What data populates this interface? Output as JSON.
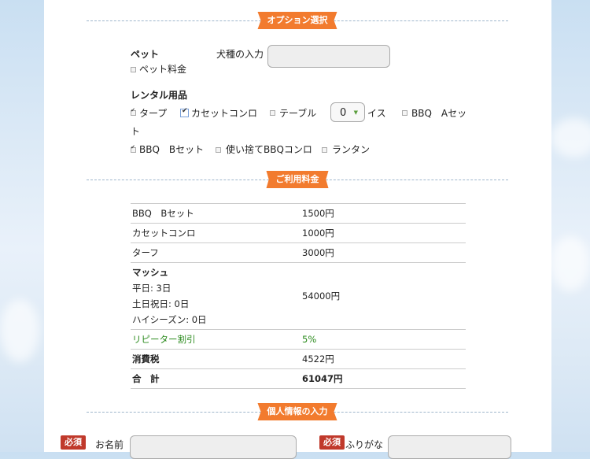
{
  "sections": {
    "options": "オプション選択",
    "fees": "ご利用料金",
    "personal": "個人情報の入力"
  },
  "pet": {
    "heading": "ペット",
    "breed_label": "犬種の入力",
    "fee_label": "ペット料金",
    "fee_checked": false
  },
  "rental": {
    "heading": "レンタル用品",
    "items": [
      {
        "label": "タープ",
        "checked": true
      },
      {
        "label": "カセットコンロ",
        "checked": true
      },
      {
        "label": "テーブル",
        "checked": false
      },
      {
        "label": "イス",
        "quantity": "0"
      },
      {
        "label": "BBQ　Aセット",
        "checked": false
      },
      {
        "label": "BBQ　Bセット",
        "checked": true
      },
      {
        "label": "使い捨てBBQコンロ",
        "checked": false
      },
      {
        "label": "ランタン",
        "checked": false
      }
    ],
    "a_set_part1": "BBQ　Aセッ",
    "a_set_part2": "ト"
  },
  "fees": {
    "rows": [
      {
        "name": "BBQ　Bセット",
        "price": "1500円"
      },
      {
        "name": "カセットコンロ",
        "price": "1000円"
      },
      {
        "name": "ターフ",
        "price": "3000円"
      }
    ],
    "site": {
      "name": "マッシュ",
      "weekday": "平日: 3日",
      "holiday": "土日祝日: 0日",
      "high_season": "ハイシーズン: 0日",
      "price": "54000円"
    },
    "discount": {
      "name": "リピーター割引",
      "value": "5%"
    },
    "tax": {
      "name": "消費税",
      "value": "4522円"
    },
    "total": {
      "name": "合　計",
      "value": "61047円"
    }
  },
  "personal": {
    "required_badge": "必須",
    "name_label": "お名前",
    "furigana_label": "ふりがな"
  },
  "colors": {
    "accent": "#f27b2e",
    "required": "#c0392b",
    "discount": "#2a8a1c"
  }
}
